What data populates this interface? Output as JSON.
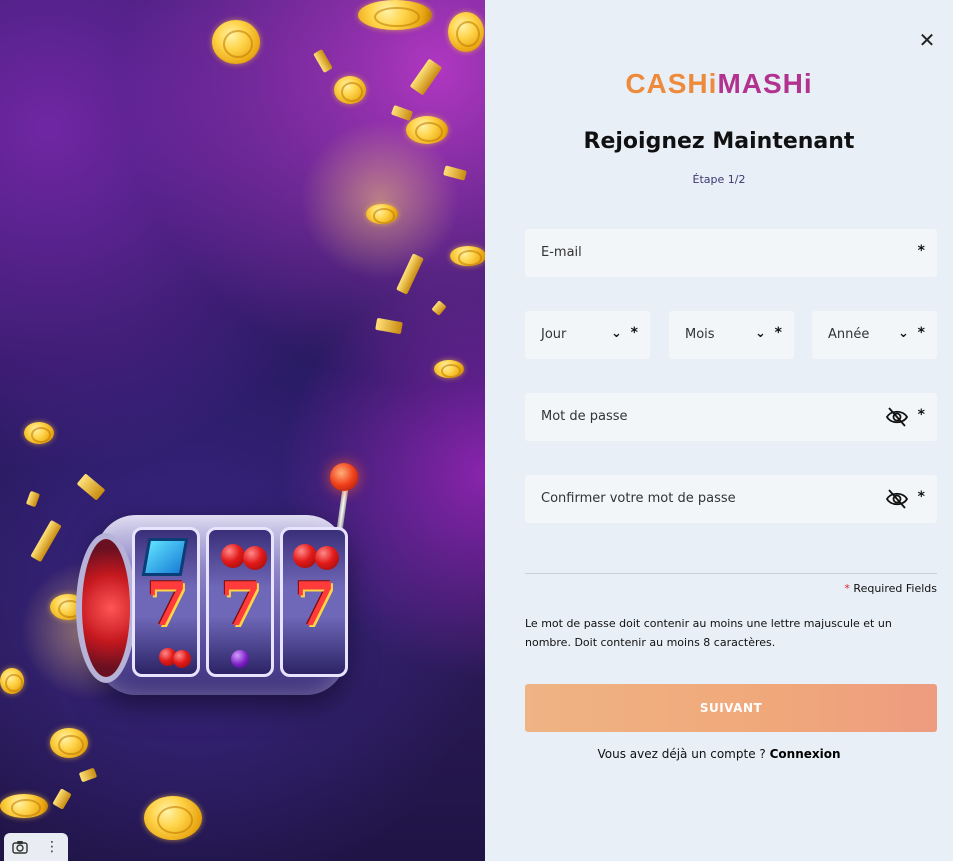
{
  "brand": {
    "logo_part1": "CASHi",
    "logo_part2": "MASHi",
    "color1": "#ee8a3b",
    "color2": "#b2338f"
  },
  "form": {
    "title": "Rejoignez Maintenant",
    "step": "Étape 1/2",
    "email_placeholder": "E-mail",
    "day_placeholder": "Jour",
    "month_placeholder": "Mois",
    "year_placeholder": "Année",
    "password_placeholder": "Mot de passe",
    "confirm_placeholder": "Confirmer votre mot de passe",
    "required_marker": "*",
    "required_note": "Required Fields",
    "password_hint": "Le mot de passe doit contenir au moins une lettre majuscule et un nombre. Doit contenir au moins 8 caractères.",
    "submit_label": "SUIVANT",
    "login_prompt": "Vous avez déjà un compte ?",
    "login_link": "Connexion"
  },
  "icons": {
    "close": "close-icon",
    "chevron": "chevron-down-icon",
    "eye": "eye-slash-icon",
    "camera": "camera-icon",
    "more": "more-vertical-icon"
  },
  "colors": {
    "submit_start": "#efb384",
    "submit_end": "#ee9c80",
    "panel_bg": "#e8eff7",
    "field_bg": "#f3f6f9"
  }
}
